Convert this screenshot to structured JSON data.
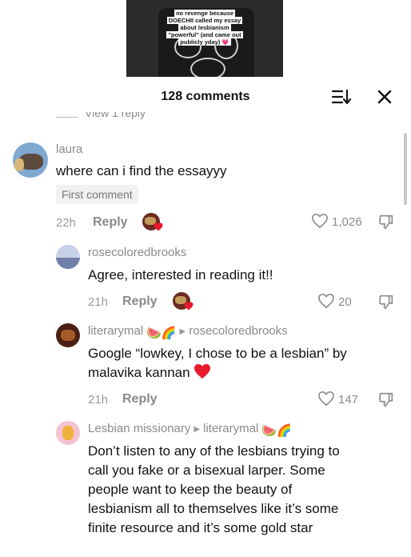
{
  "video": {
    "caption": "no revenge because DOECHII called my essay about lesbianism \"powerful\" (and came out publicly yday) 💗"
  },
  "header": {
    "title": "128 comments",
    "sort_icon": "sort-icon",
    "close_icon": "close-icon"
  },
  "partial_view_replies": "View 1 reply",
  "comments": [
    {
      "username": "laura",
      "text": "where can i find the essayyy",
      "badge": "First comment",
      "time": "22h",
      "reply_label": "Reply",
      "likes": "1,026",
      "reply_to": ""
    },
    {
      "username": "rosecoloredbrooks",
      "text": "Agree, interested in reading it!!",
      "time": "21h",
      "reply_label": "Reply",
      "likes": "20",
      "reply_to": ""
    },
    {
      "username": "literarymal",
      "username_emoji": "🍉🌈",
      "reply_to": "rosecoloredbrooks",
      "text_line1": "Google “lowkey, I chose to be a lesbian” by",
      "text_line2": "malavika kannan",
      "time": "21h",
      "reply_label": "Reply",
      "likes": "147"
    },
    {
      "username": "Lesbian missionary",
      "reply_to": "literarymal",
      "reply_to_emoji": "🍉🌈",
      "text_lines": [
        "Don’t listen to any of the lesbians trying to",
        "call you fake or a bisexual larper. Some",
        "people want to keep the beauty of",
        "lesbianism all to themselves like it’s some",
        "finite resource and it’s some gold star"
      ]
    }
  ],
  "colors": {
    "heart_red": "#e8192c",
    "text_gray": "#8a8a8a"
  }
}
